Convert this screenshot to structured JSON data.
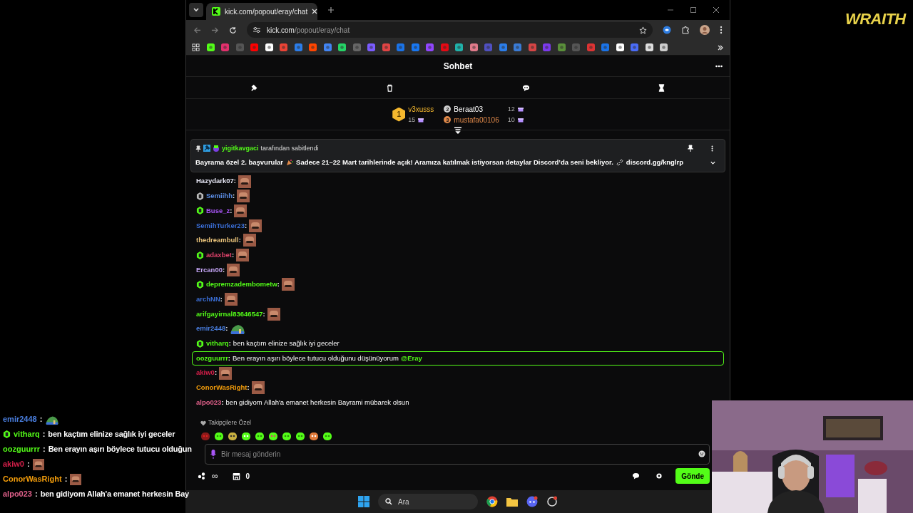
{
  "browser": {
    "tab_title": "kick.com/popout/eray/chat",
    "url_host": "kick.com",
    "url_path": "/popout/eray/chat"
  },
  "chat": {
    "title": "Sohbet",
    "leaderboard": [
      {
        "rank": "1",
        "user": "v3xusss",
        "count": "15"
      },
      {
        "rank": "2",
        "user": "Beraat03",
        "count": "12"
      },
      {
        "rank": "3",
        "user": "mustafa00106",
        "count": "10"
      }
    ],
    "pinned": {
      "pinned_by": "yigitkavgaci",
      "label": "tarafından sabitlendi",
      "message_start": "Bayrama özel 2. başvurular",
      "message_end": "Sadece 21–22 Mart tarihlerinde açık! Aramıza katılmak istiyorsan detaylar Discord’da seni bekliyor.",
      "link": "discord.gg/knglrp"
    },
    "messages": [
      {
        "kind": "face",
        "user": "Hazydark07",
        "colon": ":",
        "color": "#e4e4f2",
        "highlighted": false
      },
      {
        "kind": "face",
        "user": "Semiihh",
        "colon": ":",
        "color": "#5c8ee6",
        "badge": {
          "color": "#bbbbbb"
        },
        "highlighted": false
      },
      {
        "kind": "face",
        "user": "Buse_z",
        "colon": ":",
        "color": "#a855f7",
        "badge": {
          "color": "#53fc18"
        },
        "highlighted": false
      },
      {
        "kind": "face",
        "user": "SemihTurker23",
        "colon": ":",
        "color": "#3b6fd8",
        "highlighted": false
      },
      {
        "kind": "face",
        "user": "thedreambull",
        "colon": ":",
        "color": "#e8c27a",
        "highlighted": false
      },
      {
        "kind": "face",
        "user": "adaxbet",
        "colon": ":",
        "color": "#e0436c",
        "badge": {
          "color": "#53fc18"
        },
        "highlighted": false
      },
      {
        "kind": "face",
        "user": "Ercan00",
        "colon": ":",
        "color": "#c4a5f5",
        "highlighted": false
      },
      {
        "kind": "face",
        "user": "depremzadembometw",
        "colon": ":",
        "color": "#53fc18",
        "badge": {
          "color": "#53fc18"
        },
        "highlighted": false
      },
      {
        "kind": "face",
        "user": "archNN",
        "colon": ":",
        "color": "#3b6fd8",
        "highlighted": false
      },
      {
        "kind": "face",
        "user": "arifgayirnal83646547",
        "colon": ":",
        "color": "#53fc18",
        "highlighted": false
      },
      {
        "kind": "frog",
        "user": "emir2448",
        "colon": ":",
        "color": "#4a7fe0",
        "highlighted": false
      },
      {
        "kind": "text",
        "user": "vitharq",
        "colon": ":",
        "color": "#53fc18",
        "badge": {
          "color": "#53fc18"
        },
        "text": "ben kaçtım elinize sağlık iyi geceler",
        "highlighted": false
      },
      {
        "kind": "text",
        "user": "oozguurrr",
        "colon": ":",
        "color": "#53fc18",
        "text": "Ben erayın aşırı böylece tutucu olduğunu düşünüyorum",
        "mention": "@Eray",
        "highlighted": true
      },
      {
        "kind": "face",
        "user": "akiw0",
        "colon": ":",
        "color": "#d61f4a",
        "highlighted": false
      },
      {
        "kind": "face",
        "user": "ConorWasRight",
        "colon": ":",
        "color": "#f59e0b",
        "highlighted": false
      },
      {
        "kind": "text",
        "user": "alpo023",
        "colon": ":",
        "color": "#e0608a",
        "text": "ben gidiyom Allah'a emanet herkesin Bayrami mübarek olsun",
        "highlighted": false
      }
    ],
    "emote_section": "Takipçilere Özel",
    "input": {
      "placeholder": "Bir mesaj gönderin"
    },
    "points": "∞",
    "store_count": "0",
    "send_button": "Gönde"
  },
  "overlay_chat": [
    {
      "kind": "frog",
      "user": "emir2448",
      "colon": ":",
      "color": "#4a7fe0"
    },
    {
      "kind": "text",
      "user": "vitharq",
      "colon": ":",
      "color": "#53fc18",
      "badge": {
        "color": "#53fc18"
      },
      "text": "ben kaçtım elinize sağlık iyi geceler"
    },
    {
      "kind": "text",
      "user": "oozguurrr",
      "colon": ":",
      "color": "#53fc18",
      "text": "Ben erayın aşırı böylece tutucu olduğun"
    },
    {
      "kind": "face",
      "user": "akiw0",
      "colon": ":",
      "color": "#d61f4a"
    },
    {
      "kind": "face",
      "user": "ConorWasRight",
      "colon": ":",
      "color": "#f59e0b"
    },
    {
      "kind": "text",
      "user": "alpo023",
      "colon": ":",
      "color": "#e0608a",
      "text": "ben gidiyom Allah'a emanet herkesin Bay"
    }
  ],
  "taskbar": {
    "search": "Ara"
  },
  "logo": "WRAITH"
}
